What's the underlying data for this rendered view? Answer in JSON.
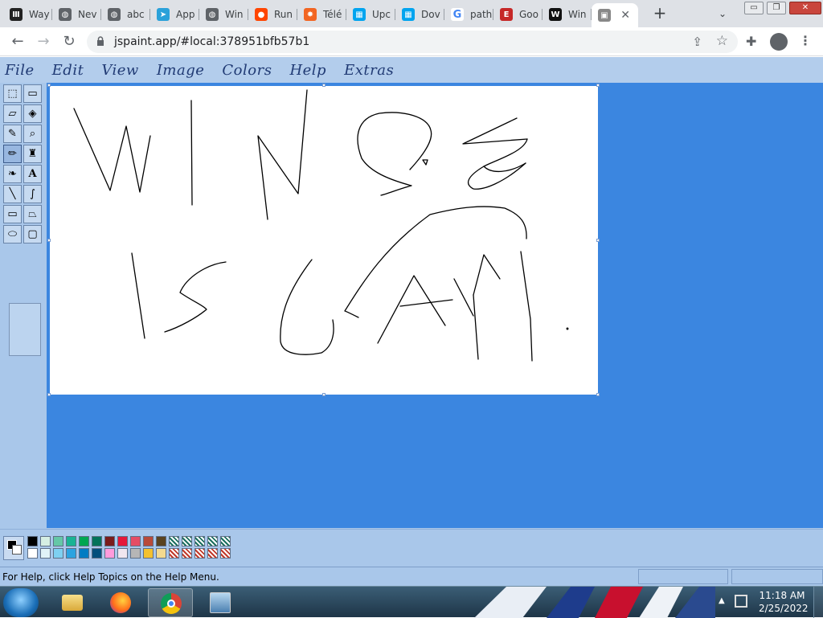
{
  "browser": {
    "tabs": [
      {
        "label": "Way",
        "favicon": "wikipedia-icon"
      },
      {
        "label": "Nev",
        "favicon": "globe-icon"
      },
      {
        "label": "abc",
        "favicon": "globe-icon"
      },
      {
        "label": "App",
        "favicon": "telegram-icon"
      },
      {
        "label": "Win",
        "favicon": "globe-icon"
      },
      {
        "label": "Run",
        "favicon": "reddit-icon"
      },
      {
        "label": "Télé",
        "favicon": "gear-icon"
      },
      {
        "label": "Upc",
        "favicon": "microsoft-icon"
      },
      {
        "label": "Dov",
        "favicon": "microsoft-icon"
      },
      {
        "label": "path",
        "favicon": "google-icon"
      },
      {
        "label": "Goo",
        "favicon": "e-icon"
      },
      {
        "label": "Win",
        "favicon": "w-icon"
      },
      {
        "label": "",
        "favicon": "jspaint-icon",
        "active": true
      }
    ],
    "url": "jspaint.app/#local:378951bfb57b1",
    "window_controls": {
      "minimize": "▭",
      "restore": "❐",
      "close": "✕"
    }
  },
  "paint": {
    "menu": [
      "File",
      "Edit",
      "View",
      "Image",
      "Colors",
      "Help",
      "Extras"
    ],
    "tools": [
      "free-form-select",
      "select",
      "eraser",
      "fill-with-color",
      "pick-color",
      "magnifier",
      "pencil",
      "brush",
      "airbrush",
      "text",
      "line",
      "curve",
      "rectangle",
      "polygon",
      "ellipse",
      "rounded-rectangle"
    ],
    "palette_top": [
      "#000000",
      "#d5eee3",
      "#65c7a7",
      "#1ab394",
      "#00a651",
      "#02725a",
      "#7a1c1c",
      "#e4183a",
      "#e44c65",
      "#b84a3a",
      "#5a4320",
      "pattern",
      "pattern",
      "pattern",
      "pattern",
      "pattern"
    ],
    "palette_bottom": [
      "#ffffff",
      "#e0f3f8",
      "#7ed0f1",
      "#2ba3e0",
      "#007cc3",
      "#004f7c",
      "#ff9bdc",
      "#f0e6ef",
      "#b6b6b6",
      "#f3c12f",
      "#f4da8f",
      "pattern",
      "pattern",
      "pattern",
      "pattern",
      "pattern"
    ],
    "status": "For Help, click Help Topics on the Help Menu."
  },
  "taskbar": {
    "time": "11:18 AM",
    "date": "2/25/2022"
  }
}
